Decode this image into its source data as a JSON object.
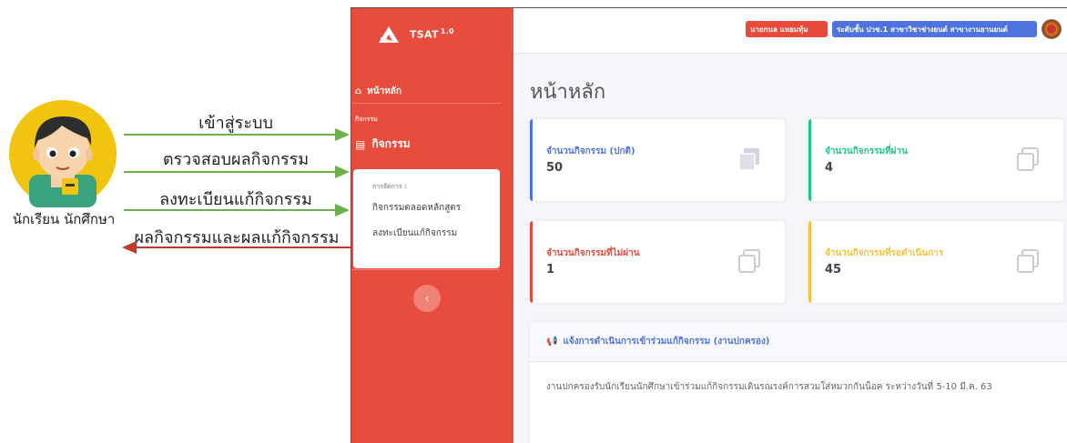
{
  "diagram": {
    "actor_label": "นักเรียน นักศึกษา",
    "flows": [
      {
        "label": "เข้าสู่ระบบ",
        "direction": "to-system"
      },
      {
        "label": "ตรวจสอบผลกิจกรรม",
        "direction": "to-system"
      },
      {
        "label": "ลงทะเบียนแก้กิจกรรม",
        "direction": "to-system"
      },
      {
        "label": "ผลกิจกรรมและผลแก้กิจกรรม",
        "direction": "to-user"
      }
    ],
    "colors": {
      "to_system": "#6ab04c",
      "to_user": "#c0392b"
    }
  },
  "app": {
    "brand": {
      "name": "TSAT",
      "version": "1.0"
    },
    "sidebar": {
      "home_label": "หน้าหลัก",
      "section_heading": "กิจกรรม",
      "activities_label": "กิจกรรม",
      "submenu_title": "การจัดการ :",
      "submenu_items": [
        "กิจกรรมตลอดหลักสูตร",
        "ลงทะเบียนแก้กิจกรรม"
      ],
      "collapse_icon": "chevron-left-icon"
    },
    "topbar": {
      "user_name": "นายกนล แหยมทุ้ม",
      "user_level": "ระดับชั้น ปวช.1 สาขาวิชาช่างยนต์ สาขางานยานยนต์"
    },
    "page_title": "หน้าหลัก",
    "cards": [
      {
        "label": "จำนวนกิจกรรม (ปกติ)",
        "value": "50",
        "color": "#4e73df"
      },
      {
        "label": "จำนวนกิจกรรมที่ผ่าน",
        "value": "4",
        "color": "#1cc88a"
      },
      {
        "label": "จำนวนกิจกรรมที่ไม่ผ่าน",
        "value": "1",
        "color": "#e74a3b"
      },
      {
        "label": "จำนวนกิจกรรมที่รอดำเนินการ",
        "value": "45",
        "color": "#f6c23e"
      }
    ],
    "notice": {
      "title": "แจ้งการดำเนินการเข้าร่วมแก้กิจกรรม (งานปกครอง)",
      "body": "งานปกครองรับนักเรียนนักศึกษาเข้าร่วมแก้กิจกรรมเดินรณรงค์การสวมใส่หมวกกันน็อค ระหว่างวันที่ 5-10 มี.ค. 63"
    },
    "accent_color": "#e74c3c"
  }
}
